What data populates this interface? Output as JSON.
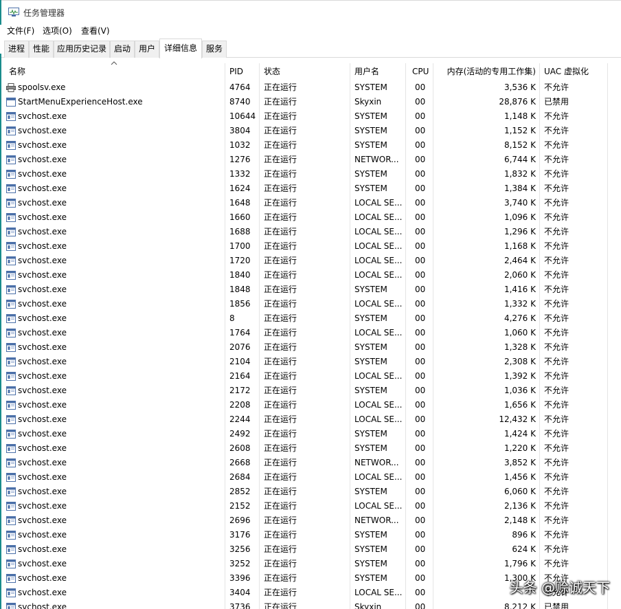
{
  "window": {
    "title": "任务管理器"
  },
  "menu": [
    "文件(F)",
    "选项(O)",
    "查看(V)"
  ],
  "tabs": [
    {
      "label": "进程",
      "active": false
    },
    {
      "label": "性能",
      "active": false
    },
    {
      "label": "应用历史记录",
      "active": false
    },
    {
      "label": "启动",
      "active": false
    },
    {
      "label": "用户",
      "active": false
    },
    {
      "label": "详细信息",
      "active": true
    },
    {
      "label": "服务",
      "active": false
    }
  ],
  "columns": {
    "name": "名称",
    "pid": "PID",
    "status": "状态",
    "user": "用户名",
    "cpu": "CPU",
    "memory": "内存(活动的专用工作集)",
    "uac": "UAC 虚拟化"
  },
  "sort": {
    "column": "name",
    "icon": "sort-ascending-icon"
  },
  "rows": [
    {
      "icon": "printer-icon",
      "name": "spoolsv.exe",
      "pid": "4764",
      "status": "正在运行",
      "user": "SYSTEM",
      "cpu": "00",
      "memory": "3,536 K",
      "uac": "不允许"
    },
    {
      "icon": "app-window-icon",
      "name": "StartMenuExperienceHost.exe",
      "pid": "8740",
      "status": "正在运行",
      "user": "Skyxin",
      "cpu": "00",
      "memory": "28,876 K",
      "uac": "已禁用"
    },
    {
      "icon": "service-icon",
      "name": "svchost.exe",
      "pid": "10644",
      "status": "正在运行",
      "user": "SYSTEM",
      "cpu": "00",
      "memory": "1,148 K",
      "uac": "不允许"
    },
    {
      "icon": "service-icon",
      "name": "svchost.exe",
      "pid": "3804",
      "status": "正在运行",
      "user": "SYSTEM",
      "cpu": "00",
      "memory": "1,152 K",
      "uac": "不允许"
    },
    {
      "icon": "service-icon",
      "name": "svchost.exe",
      "pid": "1032",
      "status": "正在运行",
      "user": "SYSTEM",
      "cpu": "00",
      "memory": "8,152 K",
      "uac": "不允许"
    },
    {
      "icon": "service-icon",
      "name": "svchost.exe",
      "pid": "1276",
      "status": "正在运行",
      "user": "NETWOR...",
      "cpu": "00",
      "memory": "6,744 K",
      "uac": "不允许"
    },
    {
      "icon": "service-icon",
      "name": "svchost.exe",
      "pid": "1332",
      "status": "正在运行",
      "user": "SYSTEM",
      "cpu": "00",
      "memory": "1,832 K",
      "uac": "不允许"
    },
    {
      "icon": "service-icon",
      "name": "svchost.exe",
      "pid": "1624",
      "status": "正在运行",
      "user": "SYSTEM",
      "cpu": "00",
      "memory": "1,384 K",
      "uac": "不允许"
    },
    {
      "icon": "service-icon",
      "name": "svchost.exe",
      "pid": "1648",
      "status": "正在运行",
      "user": "LOCAL SE...",
      "cpu": "00",
      "memory": "3,740 K",
      "uac": "不允许"
    },
    {
      "icon": "service-icon",
      "name": "svchost.exe",
      "pid": "1660",
      "status": "正在运行",
      "user": "LOCAL SE...",
      "cpu": "00",
      "memory": "1,096 K",
      "uac": "不允许"
    },
    {
      "icon": "service-icon",
      "name": "svchost.exe",
      "pid": "1688",
      "status": "正在运行",
      "user": "LOCAL SE...",
      "cpu": "00",
      "memory": "1,296 K",
      "uac": "不允许"
    },
    {
      "icon": "service-icon",
      "name": "svchost.exe",
      "pid": "1700",
      "status": "正在运行",
      "user": "LOCAL SE...",
      "cpu": "00",
      "memory": "1,168 K",
      "uac": "不允许"
    },
    {
      "icon": "service-icon",
      "name": "svchost.exe",
      "pid": "1720",
      "status": "正在运行",
      "user": "LOCAL SE...",
      "cpu": "00",
      "memory": "2,464 K",
      "uac": "不允许"
    },
    {
      "icon": "service-icon",
      "name": "svchost.exe",
      "pid": "1840",
      "status": "正在运行",
      "user": "LOCAL SE...",
      "cpu": "00",
      "memory": "2,060 K",
      "uac": "不允许"
    },
    {
      "icon": "service-icon",
      "name": "svchost.exe",
      "pid": "1848",
      "status": "正在运行",
      "user": "SYSTEM",
      "cpu": "00",
      "memory": "1,416 K",
      "uac": "不允许"
    },
    {
      "icon": "service-icon",
      "name": "svchost.exe",
      "pid": "1856",
      "status": "正在运行",
      "user": "LOCAL SE...",
      "cpu": "00",
      "memory": "1,332 K",
      "uac": "不允许"
    },
    {
      "icon": "service-icon",
      "name": "svchost.exe",
      "pid": "8",
      "status": "正在运行",
      "user": "SYSTEM",
      "cpu": "00",
      "memory": "4,276 K",
      "uac": "不允许"
    },
    {
      "icon": "service-icon",
      "name": "svchost.exe",
      "pid": "1764",
      "status": "正在运行",
      "user": "LOCAL SE...",
      "cpu": "00",
      "memory": "1,060 K",
      "uac": "不允许"
    },
    {
      "icon": "service-icon",
      "name": "svchost.exe",
      "pid": "2076",
      "status": "正在运行",
      "user": "SYSTEM",
      "cpu": "00",
      "memory": "1,328 K",
      "uac": "不允许"
    },
    {
      "icon": "service-icon",
      "name": "svchost.exe",
      "pid": "2104",
      "status": "正在运行",
      "user": "SYSTEM",
      "cpu": "00",
      "memory": "2,308 K",
      "uac": "不允许"
    },
    {
      "icon": "service-icon",
      "name": "svchost.exe",
      "pid": "2164",
      "status": "正在运行",
      "user": "LOCAL SE...",
      "cpu": "00",
      "memory": "1,392 K",
      "uac": "不允许"
    },
    {
      "icon": "service-icon",
      "name": "svchost.exe",
      "pid": "2172",
      "status": "正在运行",
      "user": "SYSTEM",
      "cpu": "00",
      "memory": "1,036 K",
      "uac": "不允许"
    },
    {
      "icon": "service-icon",
      "name": "svchost.exe",
      "pid": "2208",
      "status": "正在运行",
      "user": "LOCAL SE...",
      "cpu": "00",
      "memory": "1,656 K",
      "uac": "不允许"
    },
    {
      "icon": "service-icon",
      "name": "svchost.exe",
      "pid": "2244",
      "status": "正在运行",
      "user": "LOCAL SE...",
      "cpu": "00",
      "memory": "12,432 K",
      "uac": "不允许"
    },
    {
      "icon": "service-icon",
      "name": "svchost.exe",
      "pid": "2492",
      "status": "正在运行",
      "user": "SYSTEM",
      "cpu": "00",
      "memory": "1,424 K",
      "uac": "不允许"
    },
    {
      "icon": "service-icon",
      "name": "svchost.exe",
      "pid": "2608",
      "status": "正在运行",
      "user": "SYSTEM",
      "cpu": "00",
      "memory": "1,220 K",
      "uac": "不允许"
    },
    {
      "icon": "service-icon",
      "name": "svchost.exe",
      "pid": "2668",
      "status": "正在运行",
      "user": "NETWOR...",
      "cpu": "00",
      "memory": "3,852 K",
      "uac": "不允许"
    },
    {
      "icon": "service-icon",
      "name": "svchost.exe",
      "pid": "2684",
      "status": "正在运行",
      "user": "LOCAL SE...",
      "cpu": "00",
      "memory": "1,456 K",
      "uac": "不允许"
    },
    {
      "icon": "service-icon",
      "name": "svchost.exe",
      "pid": "2852",
      "status": "正在运行",
      "user": "SYSTEM",
      "cpu": "00",
      "memory": "6,060 K",
      "uac": "不允许"
    },
    {
      "icon": "service-icon",
      "name": "svchost.exe",
      "pid": "2152",
      "status": "正在运行",
      "user": "LOCAL SE...",
      "cpu": "00",
      "memory": "2,136 K",
      "uac": "不允许"
    },
    {
      "icon": "service-icon",
      "name": "svchost.exe",
      "pid": "2696",
      "status": "正在运行",
      "user": "NETWOR...",
      "cpu": "00",
      "memory": "2,148 K",
      "uac": "不允许"
    },
    {
      "icon": "service-icon",
      "name": "svchost.exe",
      "pid": "3176",
      "status": "正在运行",
      "user": "SYSTEM",
      "cpu": "00",
      "memory": "896 K",
      "uac": "不允许"
    },
    {
      "icon": "service-icon",
      "name": "svchost.exe",
      "pid": "3256",
      "status": "正在运行",
      "user": "SYSTEM",
      "cpu": "00",
      "memory": "624 K",
      "uac": "不允许"
    },
    {
      "icon": "service-icon",
      "name": "svchost.exe",
      "pid": "3252",
      "status": "正在运行",
      "user": "SYSTEM",
      "cpu": "00",
      "memory": "1,796 K",
      "uac": "不允许"
    },
    {
      "icon": "service-icon",
      "name": "svchost.exe",
      "pid": "3396",
      "status": "正在运行",
      "user": "SYSTEM",
      "cpu": "00",
      "memory": "1,300 K",
      "uac": "不允许"
    },
    {
      "icon": "service-icon",
      "name": "svchost.exe",
      "pid": "3404",
      "status": "正在运行",
      "user": "LOCAL SE...",
      "cpu": "00",
      "memory": "",
      "uac": "不允许"
    },
    {
      "icon": "service-icon",
      "name": "svchost.exe",
      "pid": "3736",
      "status": "正在运行",
      "user": "Skyxin",
      "cpu": "00",
      "memory": "8,212 K",
      "uac": "已禁用"
    }
  ],
  "watermark": "头条 @赊诚天下"
}
